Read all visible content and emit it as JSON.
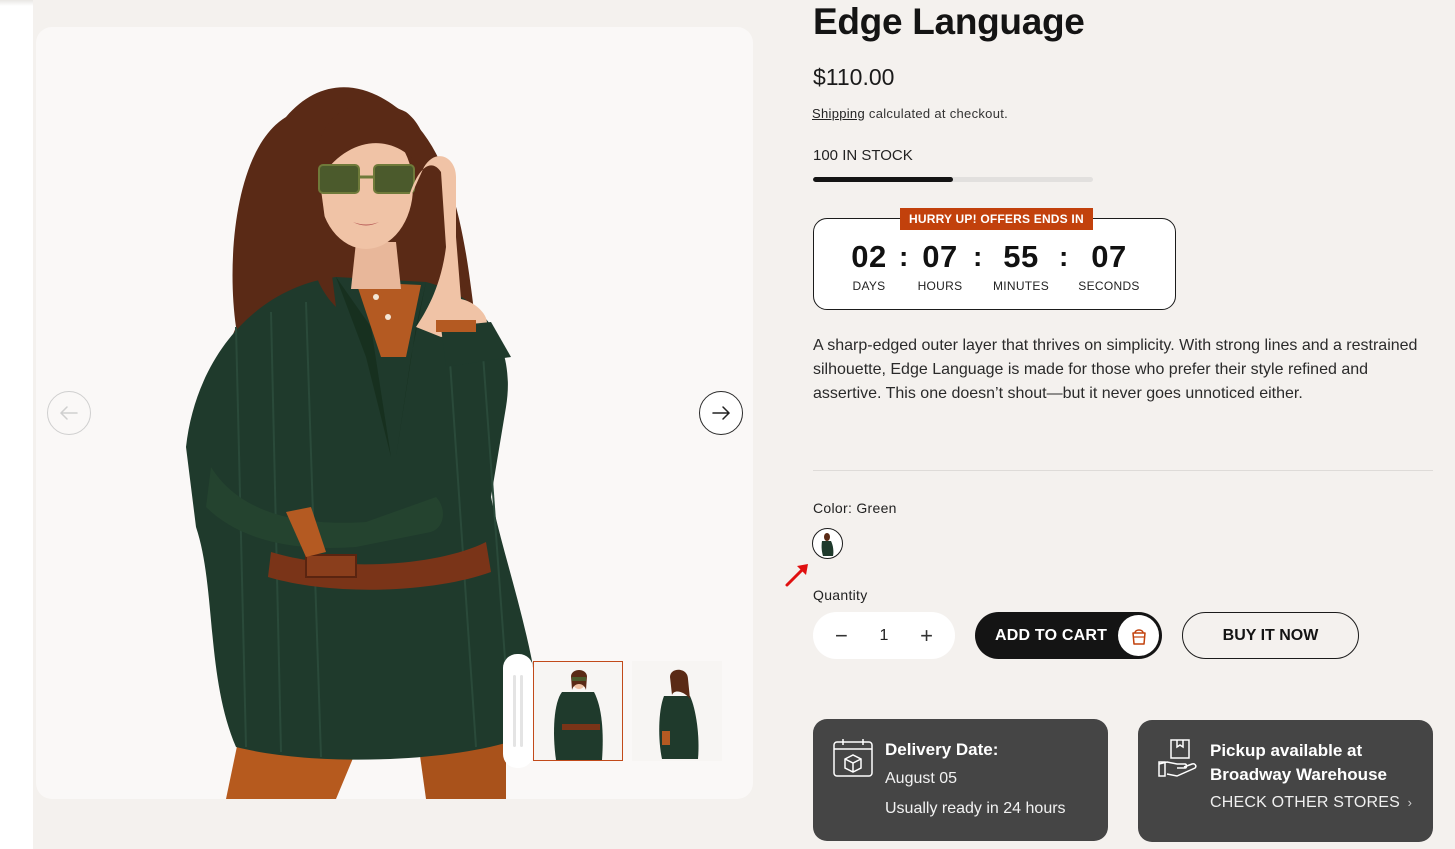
{
  "product": {
    "title": "Edge Language",
    "price": "$110.00",
    "shipping_link": "Shipping",
    "shipping_text": " calculated at checkout.",
    "stock_text": "100 IN STOCK",
    "stock_level_percent": 50,
    "description": "A sharp-edged outer layer that thrives on simplicity. With strong lines and a restrained silhouette, Edge Language is made for those who prefer their style refined and assertive. This one doesn’t shout—but it never goes unnoticed either."
  },
  "countdown": {
    "banner": "HURRY UP! OFFERS ENDS IN",
    "days": "02",
    "days_label": "DAYS",
    "hours": "07",
    "hours_label": "HOURS",
    "minutes": "55",
    "minutes_label": "MINUTES",
    "seconds": "07",
    "seconds_label": "SECONDS",
    "separator": ":"
  },
  "variant": {
    "color_label": "Color: Green"
  },
  "quantity": {
    "label": "Quantity",
    "value": "1",
    "minus": "−",
    "plus": "+"
  },
  "actions": {
    "add_to_cart": "ADD TO CART",
    "buy_now": "BUY IT NOW"
  },
  "delivery": {
    "title": "Delivery Date:",
    "date": "August 05",
    "note": "Usually ready in 24 hours"
  },
  "pickup": {
    "title": "Pickup available at Broadway Warehouse",
    "link": "CHECK OTHER STORES",
    "link_chevron": "›"
  },
  "icons": {
    "prev": "arrow-left-icon",
    "next": "arrow-right-icon",
    "cart": "shopping-bag-icon",
    "calendar": "calendar-box-icon",
    "pickup": "hand-package-icon"
  },
  "colors": {
    "accent": "#c2410c",
    "dark": "#141414",
    "card": "#454545",
    "page_bg": "#f4f1ee"
  }
}
